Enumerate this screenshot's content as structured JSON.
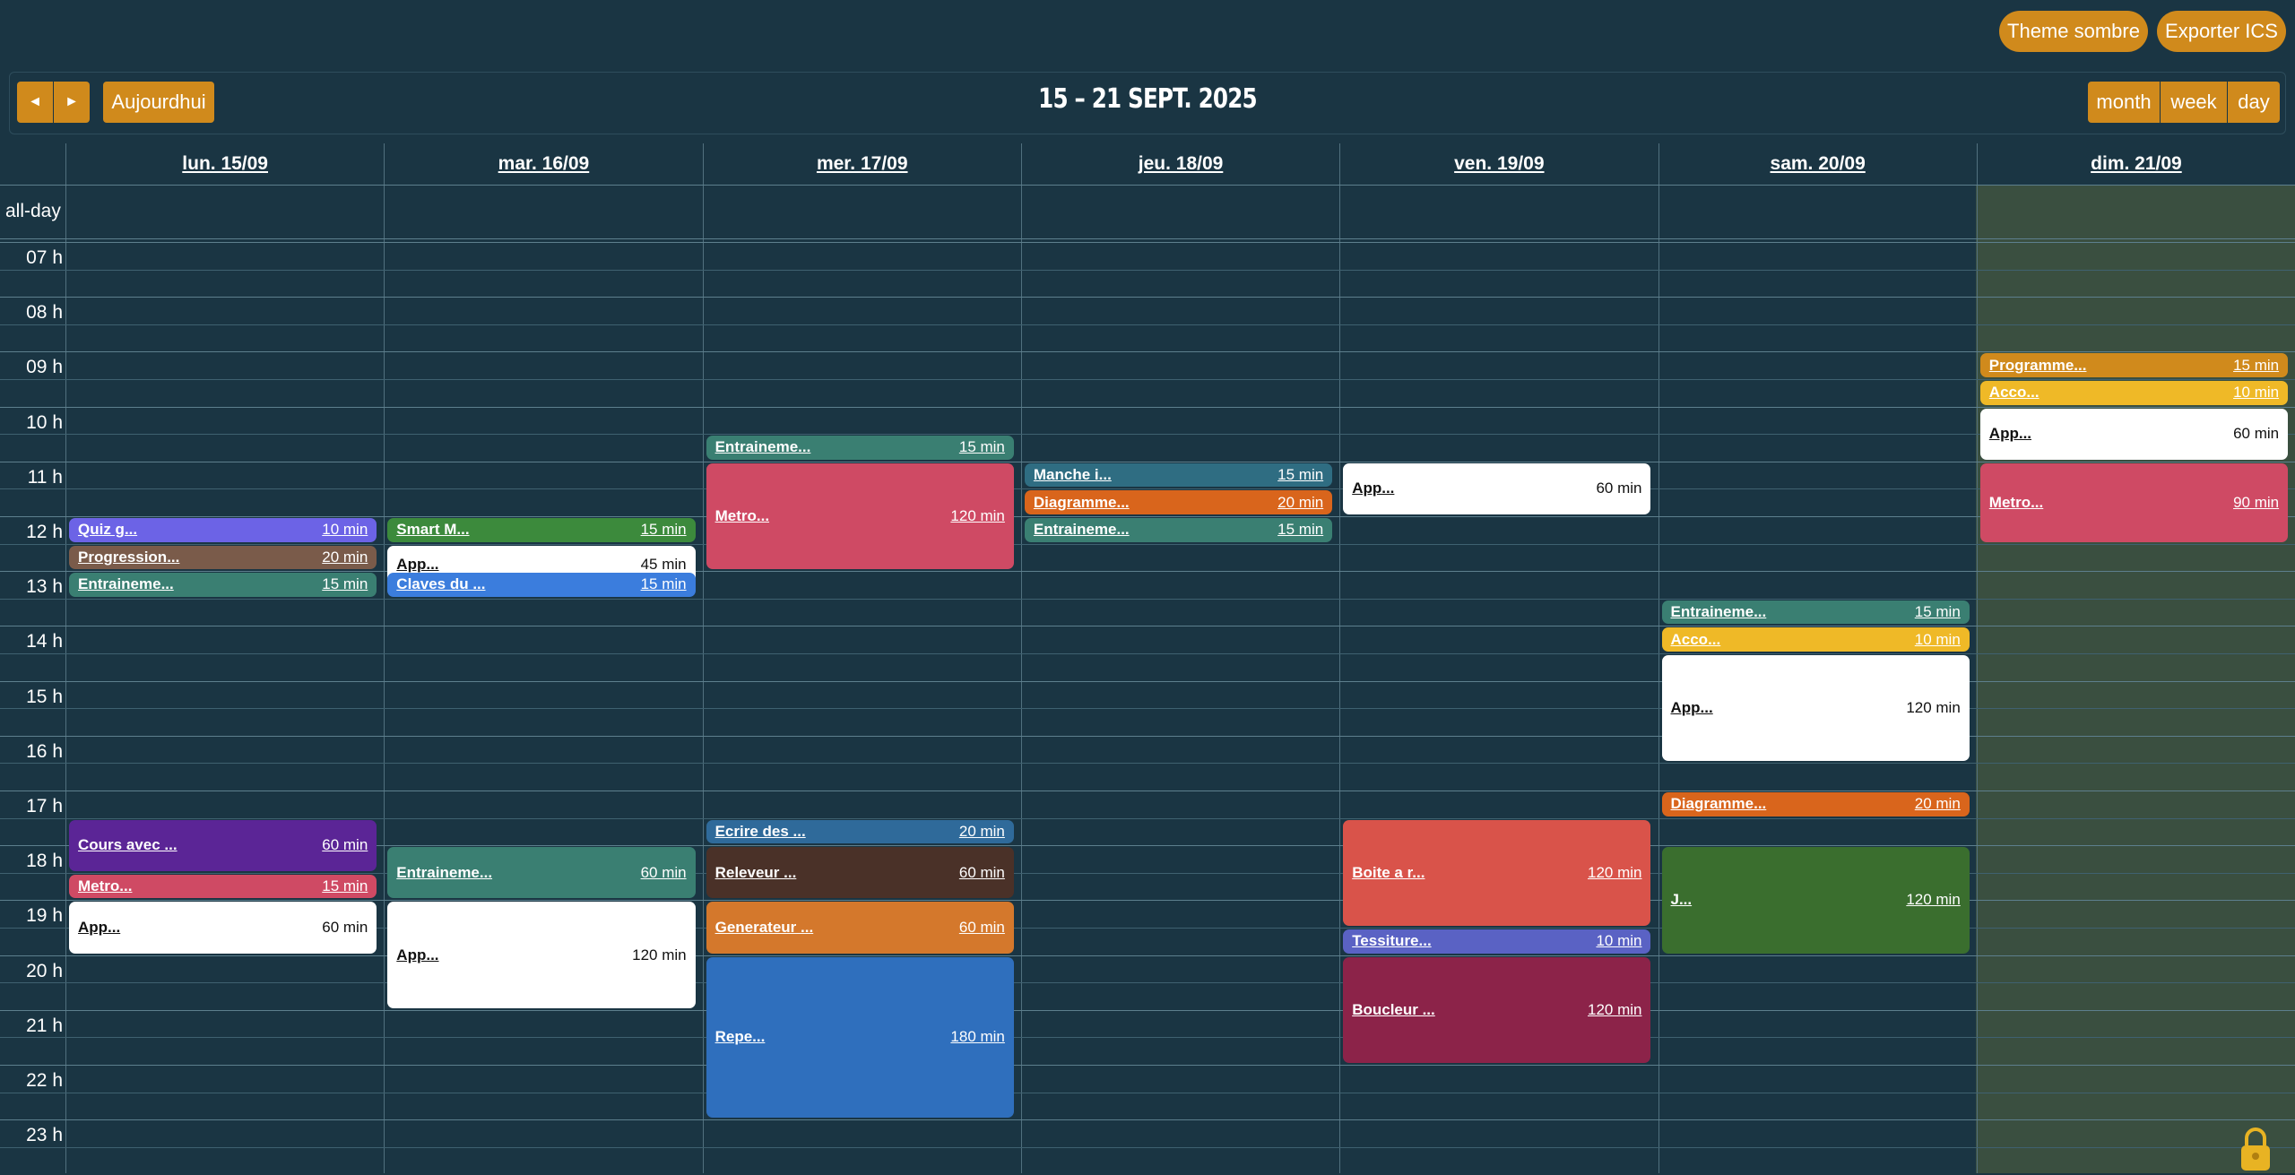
{
  "top_buttons": {
    "theme": "Theme sombre",
    "export": "Exporter ICS"
  },
  "toolbar": {
    "prev_icon": "◄",
    "next_icon": "►",
    "today": "Aujourdhui",
    "title": "15 – 21 SEPT. 2025",
    "views": [
      "month",
      "week",
      "day"
    ]
  },
  "allday_label": "all-day",
  "days": [
    "lun. 15/09",
    "mar. 16/09",
    "mer. 17/09",
    "jeu. 18/09",
    "ven. 19/09",
    "sam. 20/09",
    "dim. 21/09"
  ],
  "hours": [
    "07 h",
    "08 h",
    "09 h",
    "10 h",
    "11 h",
    "12 h",
    "13 h",
    "14 h",
    "15 h",
    "16 h",
    "17 h",
    "18 h",
    "19 h",
    "20 h",
    "21 h",
    "22 h",
    "23 h"
  ],
  "events": [
    {
      "day": 0,
      "start": "12:00",
      "dur": "10 min",
      "title": "Quiz g...",
      "color": "#6c63e6"
    },
    {
      "day": 0,
      "start": "12:30",
      "dur": "20 min",
      "title": "Progression...",
      "color": "#7a5b4a"
    },
    {
      "day": 0,
      "start": "13:00",
      "dur": "15 min",
      "title": "Entraineme...",
      "color": "#3a7f72"
    },
    {
      "day": 0,
      "start": "17:30",
      "dur": "60 min",
      "title": "Cours avec ...",
      "color": "#5b2596"
    },
    {
      "day": 0,
      "start": "18:30",
      "dur": "15 min",
      "title": "Metro...",
      "color": "#cf4a64"
    },
    {
      "day": 0,
      "start": "19:00",
      "dur": "60 min",
      "title": "App...",
      "color": "#ffffff"
    },
    {
      "day": 1,
      "start": "12:00",
      "dur": "15 min",
      "title": "Smart M...",
      "color": "#3c8a3c"
    },
    {
      "day": 1,
      "start": "12:30",
      "dur": "45 min",
      "title": "App...",
      "color": "#ffffff"
    },
    {
      "day": 1,
      "start": "13:00",
      "dur": "15 min",
      "title": "Claves du ...",
      "color": "#3b7ddd"
    },
    {
      "day": 1,
      "start": "18:00",
      "dur": "60 min",
      "title": "Entraineme...",
      "color": "#3a7f72"
    },
    {
      "day": 1,
      "start": "19:00",
      "dur": "120 min",
      "title": "App...",
      "color": "#ffffff"
    },
    {
      "day": 2,
      "start": "10:30",
      "dur": "15 min",
      "title": "Entraineme...",
      "color": "#3a7f72"
    },
    {
      "day": 2,
      "start": "11:00",
      "dur": "120 min",
      "title": "Metro...",
      "color": "#cf4a64"
    },
    {
      "day": 2,
      "start": "17:30",
      "dur": "20 min",
      "title": "Ecrire des ...",
      "color": "#2f6a9a"
    },
    {
      "day": 2,
      "start": "18:00",
      "dur": "60 min",
      "title": "Releveur ...",
      "color": "#4a3128"
    },
    {
      "day": 2,
      "start": "19:00",
      "dur": "60 min",
      "title": "Generateur ...",
      "color": "#d4782c"
    },
    {
      "day": 2,
      "start": "20:00",
      "dur": "180 min",
      "title": "Repe...",
      "color": "#2f6fbd"
    },
    {
      "day": 3,
      "start": "11:00",
      "dur": "15 min",
      "title": "Manche i...",
      "color": "#2f6d82"
    },
    {
      "day": 3,
      "start": "11:30",
      "dur": "20 min",
      "title": "Diagramme...",
      "color": "#d9651c"
    },
    {
      "day": 3,
      "start": "12:00",
      "dur": "15 min",
      "title": "Entraineme...",
      "color": "#3a7f72"
    },
    {
      "day": 4,
      "start": "11:00",
      "dur": "60 min",
      "title": "App...",
      "color": "#ffffff"
    },
    {
      "day": 4,
      "start": "17:30",
      "dur": "120 min",
      "title": "Boite a r...",
      "color": "#d9534a"
    },
    {
      "day": 4,
      "start": "19:30",
      "dur": "10 min",
      "title": "Tessiture...",
      "color": "#5a62c4"
    },
    {
      "day": 4,
      "start": "20:00",
      "dur": "120 min",
      "title": "Boucleur ...",
      "color": "#8c2349"
    },
    {
      "day": 5,
      "start": "13:30",
      "dur": "15 min",
      "title": "Entraineme...",
      "color": "#3a7f72"
    },
    {
      "day": 5,
      "start": "14:00",
      "dur": "10 min",
      "title": "Acco...",
      "color": "#efb927"
    },
    {
      "day": 5,
      "start": "14:30",
      "dur": "120 min",
      "title": "App...",
      "color": "#ffffff"
    },
    {
      "day": 5,
      "start": "17:00",
      "dur": "20 min",
      "title": "Diagramme...",
      "color": "#d9651c"
    },
    {
      "day": 5,
      "start": "18:00",
      "dur": "120 min",
      "title": "J...",
      "color": "#3a6e2e"
    },
    {
      "day": 6,
      "start": "09:00",
      "dur": "15 min",
      "title": "Programme...",
      "color": "#d08a1c"
    },
    {
      "day": 6,
      "start": "09:30",
      "dur": "10 min",
      "title": "Acco...",
      "color": "#efb927"
    },
    {
      "day": 6,
      "start": "10:00",
      "dur": "60 min",
      "title": "App...",
      "color": "#ffffff"
    },
    {
      "day": 6,
      "start": "11:00",
      "dur": "90 min",
      "title": "Metro...",
      "color": "#cf4a64"
    }
  ],
  "colors": {
    "background": "#1a3543",
    "accent": "#d08a1c",
    "today_column": "#3a4f40"
  },
  "icons": {
    "lock": "lock-icon"
  }
}
